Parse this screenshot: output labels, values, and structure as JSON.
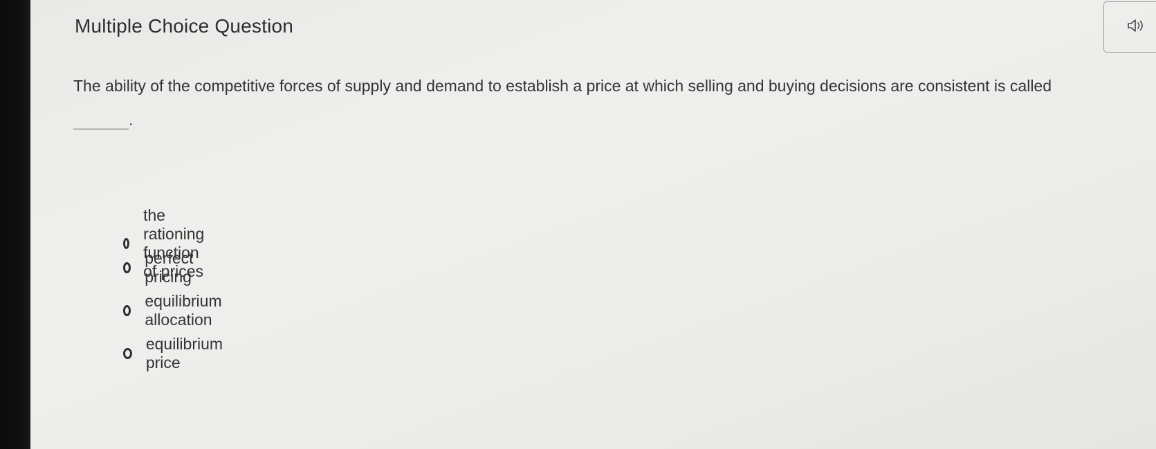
{
  "header": {
    "title": "Multiple Choice Question",
    "audio_icon": "speaker-icon"
  },
  "question": {
    "text": "The ability of the competitive forces of supply and demand to establish a price at which selling and buying decisions are consistent is called",
    "blank_suffix": "."
  },
  "options": [
    {
      "label": "the rationing function of prices",
      "selected": false
    },
    {
      "label": "perfect pricing",
      "selected": false
    },
    {
      "label": "equilibrium allocation",
      "selected": false
    },
    {
      "label": "equilibrium price",
      "selected": false
    }
  ]
}
